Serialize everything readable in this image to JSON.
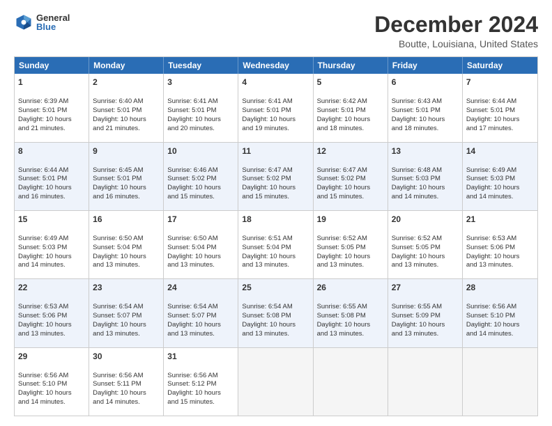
{
  "logo": {
    "general": "General",
    "blue": "Blue"
  },
  "title": "December 2024",
  "subtitle": "Boutte, Louisiana, United States",
  "days": [
    "Sunday",
    "Monday",
    "Tuesday",
    "Wednesday",
    "Thursday",
    "Friday",
    "Saturday"
  ],
  "rows": [
    [
      {
        "day": "1",
        "lines": [
          "Sunrise: 6:39 AM",
          "Sunset: 5:01 PM",
          "Daylight: 10 hours",
          "and 21 minutes."
        ]
      },
      {
        "day": "2",
        "lines": [
          "Sunrise: 6:40 AM",
          "Sunset: 5:01 PM",
          "Daylight: 10 hours",
          "and 21 minutes."
        ]
      },
      {
        "day": "3",
        "lines": [
          "Sunrise: 6:41 AM",
          "Sunset: 5:01 PM",
          "Daylight: 10 hours",
          "and 20 minutes."
        ]
      },
      {
        "day": "4",
        "lines": [
          "Sunrise: 6:41 AM",
          "Sunset: 5:01 PM",
          "Daylight: 10 hours",
          "and 19 minutes."
        ]
      },
      {
        "day": "5",
        "lines": [
          "Sunrise: 6:42 AM",
          "Sunset: 5:01 PM",
          "Daylight: 10 hours",
          "and 18 minutes."
        ]
      },
      {
        "day": "6",
        "lines": [
          "Sunrise: 6:43 AM",
          "Sunset: 5:01 PM",
          "Daylight: 10 hours",
          "and 18 minutes."
        ]
      },
      {
        "day": "7",
        "lines": [
          "Sunrise: 6:44 AM",
          "Sunset: 5:01 PM",
          "Daylight: 10 hours",
          "and 17 minutes."
        ]
      }
    ],
    [
      {
        "day": "8",
        "lines": [
          "Sunrise: 6:44 AM",
          "Sunset: 5:01 PM",
          "Daylight: 10 hours",
          "and 16 minutes."
        ]
      },
      {
        "day": "9",
        "lines": [
          "Sunrise: 6:45 AM",
          "Sunset: 5:01 PM",
          "Daylight: 10 hours",
          "and 16 minutes."
        ]
      },
      {
        "day": "10",
        "lines": [
          "Sunrise: 6:46 AM",
          "Sunset: 5:02 PM",
          "Daylight: 10 hours",
          "and 15 minutes."
        ]
      },
      {
        "day": "11",
        "lines": [
          "Sunrise: 6:47 AM",
          "Sunset: 5:02 PM",
          "Daylight: 10 hours",
          "and 15 minutes."
        ]
      },
      {
        "day": "12",
        "lines": [
          "Sunrise: 6:47 AM",
          "Sunset: 5:02 PM",
          "Daylight: 10 hours",
          "and 15 minutes."
        ]
      },
      {
        "day": "13",
        "lines": [
          "Sunrise: 6:48 AM",
          "Sunset: 5:03 PM",
          "Daylight: 10 hours",
          "and 14 minutes."
        ]
      },
      {
        "day": "14",
        "lines": [
          "Sunrise: 6:49 AM",
          "Sunset: 5:03 PM",
          "Daylight: 10 hours",
          "and 14 minutes."
        ]
      }
    ],
    [
      {
        "day": "15",
        "lines": [
          "Sunrise: 6:49 AM",
          "Sunset: 5:03 PM",
          "Daylight: 10 hours",
          "and 14 minutes."
        ]
      },
      {
        "day": "16",
        "lines": [
          "Sunrise: 6:50 AM",
          "Sunset: 5:04 PM",
          "Daylight: 10 hours",
          "and 13 minutes."
        ]
      },
      {
        "day": "17",
        "lines": [
          "Sunrise: 6:50 AM",
          "Sunset: 5:04 PM",
          "Daylight: 10 hours",
          "and 13 minutes."
        ]
      },
      {
        "day": "18",
        "lines": [
          "Sunrise: 6:51 AM",
          "Sunset: 5:04 PM",
          "Daylight: 10 hours",
          "and 13 minutes."
        ]
      },
      {
        "day": "19",
        "lines": [
          "Sunrise: 6:52 AM",
          "Sunset: 5:05 PM",
          "Daylight: 10 hours",
          "and 13 minutes."
        ]
      },
      {
        "day": "20",
        "lines": [
          "Sunrise: 6:52 AM",
          "Sunset: 5:05 PM",
          "Daylight: 10 hours",
          "and 13 minutes."
        ]
      },
      {
        "day": "21",
        "lines": [
          "Sunrise: 6:53 AM",
          "Sunset: 5:06 PM",
          "Daylight: 10 hours",
          "and 13 minutes."
        ]
      }
    ],
    [
      {
        "day": "22",
        "lines": [
          "Sunrise: 6:53 AM",
          "Sunset: 5:06 PM",
          "Daylight: 10 hours",
          "and 13 minutes."
        ]
      },
      {
        "day": "23",
        "lines": [
          "Sunrise: 6:54 AM",
          "Sunset: 5:07 PM",
          "Daylight: 10 hours",
          "and 13 minutes."
        ]
      },
      {
        "day": "24",
        "lines": [
          "Sunrise: 6:54 AM",
          "Sunset: 5:07 PM",
          "Daylight: 10 hours",
          "and 13 minutes."
        ]
      },
      {
        "day": "25",
        "lines": [
          "Sunrise: 6:54 AM",
          "Sunset: 5:08 PM",
          "Daylight: 10 hours",
          "and 13 minutes."
        ]
      },
      {
        "day": "26",
        "lines": [
          "Sunrise: 6:55 AM",
          "Sunset: 5:08 PM",
          "Daylight: 10 hours",
          "and 13 minutes."
        ]
      },
      {
        "day": "27",
        "lines": [
          "Sunrise: 6:55 AM",
          "Sunset: 5:09 PM",
          "Daylight: 10 hours",
          "and 13 minutes."
        ]
      },
      {
        "day": "28",
        "lines": [
          "Sunrise: 6:56 AM",
          "Sunset: 5:10 PM",
          "Daylight: 10 hours",
          "and 14 minutes."
        ]
      }
    ],
    [
      {
        "day": "29",
        "lines": [
          "Sunrise: 6:56 AM",
          "Sunset: 5:10 PM",
          "Daylight: 10 hours",
          "and 14 minutes."
        ]
      },
      {
        "day": "30",
        "lines": [
          "Sunrise: 6:56 AM",
          "Sunset: 5:11 PM",
          "Daylight: 10 hours",
          "and 14 minutes."
        ]
      },
      {
        "day": "31",
        "lines": [
          "Sunrise: 6:56 AM",
          "Sunset: 5:12 PM",
          "Daylight: 10 hours",
          "and 15 minutes."
        ]
      },
      null,
      null,
      null,
      null
    ]
  ],
  "colors": {
    "header_bg": "#2a6db5",
    "alt_row": "#eef3fb",
    "empty": "#f5f5f5"
  }
}
